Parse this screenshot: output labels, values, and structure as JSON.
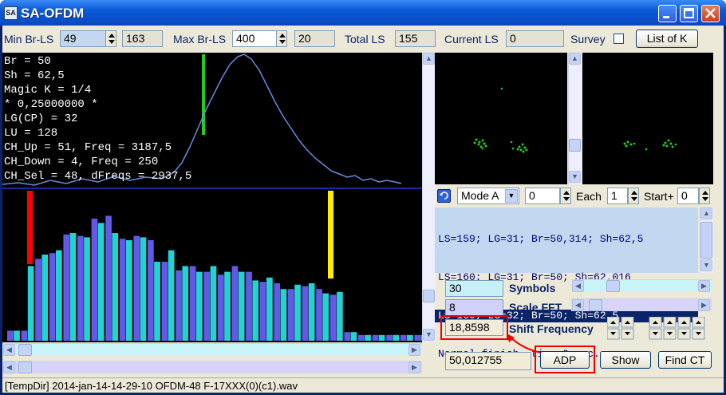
{
  "window": {
    "title": "SA-OFDM",
    "icon_text": "SA"
  },
  "toolbar": {
    "min_br_label": "Min Br-LS",
    "min_br_value": "49",
    "min_br_value2": "163",
    "max_br_label": "Max Br-LS",
    "max_br_value": "400",
    "max_br_value2": "20",
    "total_ls_label": "Total LS",
    "total_ls_value": "155",
    "current_ls_label": "Current LS",
    "current_ls_value": "0",
    "survey_label": "Survey",
    "list_of_k_label": "List of K"
  },
  "info": {
    "lines": [
      "Br = 50",
      "Sh = 62,5",
      "Magic K = 1/4",
      "* 0,25000000 *",
      "LG(CP) = 32",
      "LU = 128",
      "CH_Up = 51, Freq = 3187,5",
      "CH_Down = 4, Freq = 250",
      "CH_Sel = 48, dFreqs = 2937,5"
    ]
  },
  "controls": {
    "mode_value": "Mode A",
    "mode_num": "0",
    "each_label": "Each",
    "each_value": "1",
    "start_label": "Start+",
    "start_value": "0"
  },
  "log": {
    "rows": [
      "LS=159; LG=31; Br=50,314; Sh=62,5",
      "LS=160; LG=31; Br=50; Sh=62,016",
      "LS=160; LG=32; Br=50; Sh=62,5",
      "Normal finish, time 0 sec."
    ],
    "selected_index": 2
  },
  "params": {
    "symbols_value": "30",
    "symbols_label": "Symbols",
    "scale_fft_value": "8",
    "scale_fft_label": "Scale FFT",
    "shift_value": "18,8598",
    "shift_label": "Shift Frequency",
    "freq_value": "50,012755",
    "adp_label": "ADP",
    "show_label": "Show",
    "find_ct_label": "Find CT"
  },
  "status": {
    "text": "[TempDir] 2014-jan-14-14-29-10 OFDM-48 F-17XXX(0)(c1).wav"
  },
  "colors": {
    "bar_cyan": "#22d3d3",
    "bar_purple": "#6658e6",
    "marker_red": "#ff0000",
    "marker_yellow": "#ffee00",
    "marker_green": "#22cc22",
    "curve": "#6a8adf"
  },
  "spectrum_bars": [
    {
      "a": 0.07,
      "b": 0.07
    },
    {
      "a": 0.07,
      "b": 0.52
    },
    {
      "a": 0.57,
      "b": 0.6
    },
    {
      "a": 0.61,
      "b": 0.63
    },
    {
      "a": 0.74,
      "b": 0.75
    },
    {
      "a": 0.73,
      "b": 0.72
    },
    {
      "a": 0.85,
      "b": 0.82
    },
    {
      "a": 0.87,
      "b": 0.75
    },
    {
      "a": 0.71,
      "b": 0.7
    },
    {
      "a": 0.73,
      "b": 0.72
    },
    {
      "a": 0.7,
      "b": 0.55
    },
    {
      "a": 0.55,
      "b": 0.63
    },
    {
      "a": 0.49,
      "b": 0.52
    },
    {
      "a": 0.52,
      "b": 0.48
    },
    {
      "a": 0.48,
      "b": 0.52
    },
    {
      "a": 0.46,
      "b": 0.48
    },
    {
      "a": 0.52,
      "b": 0.48
    },
    {
      "a": 0.48,
      "b": 0.42
    },
    {
      "a": 0.41,
      "b": 0.44
    },
    {
      "a": 0.4,
      "b": 0.36
    },
    {
      "a": 0.36,
      "b": 0.39
    },
    {
      "a": 0.38,
      "b": 0.4
    },
    {
      "a": 0.36,
      "b": 0.33
    },
    {
      "a": 0.32,
      "b": 0.34
    },
    {
      "a": 0.06,
      "b": 0.06
    },
    {
      "a": 0.04,
      "b": 0.04
    },
    {
      "a": 0.04,
      "b": 0.04
    },
    {
      "a": 0.04,
      "b": 0.04
    },
    {
      "a": 0.04,
      "b": 0.04
    },
    {
      "a": 0.04,
      "b": 0.04
    }
  ]
}
